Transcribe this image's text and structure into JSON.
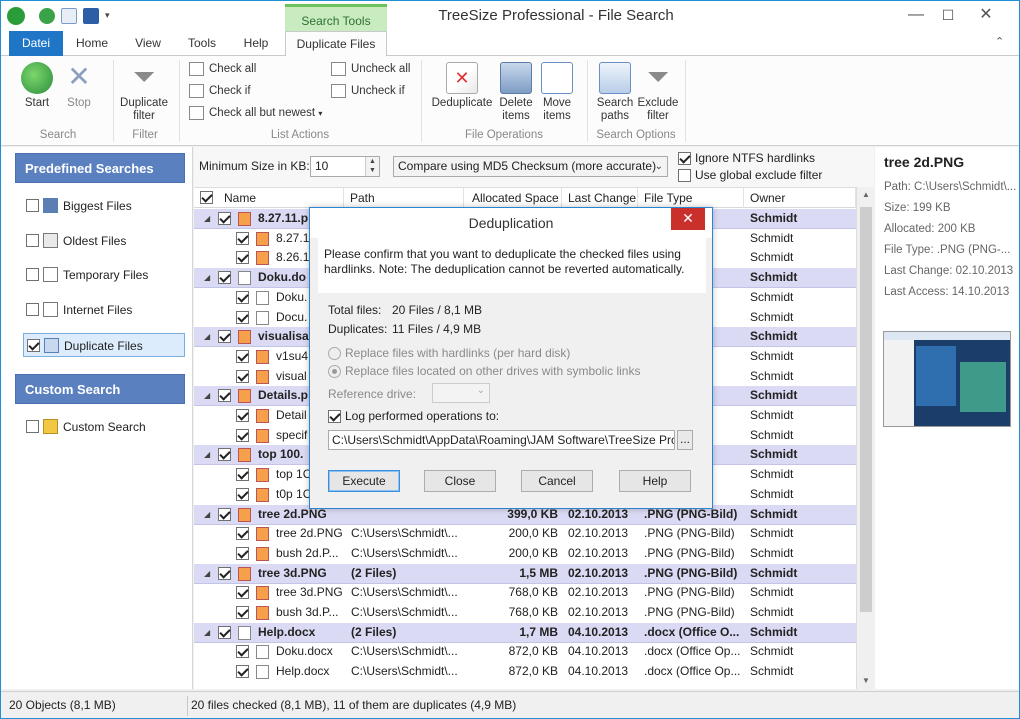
{
  "window": {
    "title": "TreeSize Professional - File Search",
    "context_tab": "Search Tools",
    "controls": {
      "minimize": "—",
      "maximize": "☐",
      "close": "✕"
    }
  },
  "ribbon_tabs": [
    "Datei",
    "Home",
    "View",
    "Tools",
    "Help",
    "Duplicate Files"
  ],
  "ribbon": {
    "start": "Start",
    "stop": "Stop",
    "search_group": "Search",
    "dup_filter_1": "Duplicate",
    "dup_filter_2": "filter",
    "filter_group": "Filter",
    "check_all": "Check all",
    "check_if": "Check if",
    "check_all_but_newest": "Check all but newest",
    "uncheck_all": "Uncheck all",
    "uncheck_if": "Uncheck if",
    "list_actions_group": "List Actions",
    "deduplicate": "Deduplicate",
    "delete_1": "Delete",
    "delete_2": "items",
    "move_1": "Move",
    "move_2": "items",
    "file_ops_group": "File Operations",
    "search_paths_1": "Search",
    "search_paths_2": "paths",
    "exclude_1": "Exclude",
    "exclude_2": "filter",
    "search_options_group": "Search Options"
  },
  "left_panel": {
    "predefined_header": "Predefined Searches",
    "predefined_items": [
      "Biggest Files",
      "Oldest Files",
      "Temporary Files",
      "Internet Files",
      "Duplicate Files"
    ],
    "custom_header": "Custom Search",
    "custom_item": "Custom Search"
  },
  "filterbar": {
    "min_size_label": "Minimum Size in KB:",
    "min_size_value": "10",
    "compare_mode": "Compare using MD5 Checksum (more accurate)",
    "ignore_hardlinks": "Ignore NTFS hardlinks",
    "global_exclude": "Use global exclude filter"
  },
  "grid": {
    "columns": [
      "Name",
      "Path",
      "Allocated Space",
      "Last Change",
      "File Type",
      "Owner"
    ],
    "rows": [
      {
        "g": true,
        "name": "8.27.11.p",
        "path": "",
        "size": "",
        "date": "",
        "type": "Bild)",
        "owner": "Schmidt"
      },
      {
        "g": false,
        "name": "8.27.1",
        "path": "",
        "size": "",
        "date": "",
        "type": "Bild)",
        "owner": "Schmidt"
      },
      {
        "g": false,
        "name": "8.26.1",
        "path": "",
        "size": "",
        "date": "",
        "type": "Bild)",
        "owner": "Schmidt"
      },
      {
        "g": true,
        "name": "Doku.do",
        "path": "",
        "size": "",
        "date": "",
        "type": "e O...",
        "owner": "Schmidt"
      },
      {
        "g": false,
        "name": "Doku.",
        "path": "",
        "size": "",
        "date": "",
        "type": "e Op...",
        "owner": "Schmidt"
      },
      {
        "g": false,
        "name": "Docu.",
        "path": "",
        "size": "",
        "date": "",
        "type": "e Op...",
        "owner": "Schmidt"
      },
      {
        "g": true,
        "name": "visualisat",
        "path": "",
        "size": "",
        "date": "",
        "type": "Bild)",
        "owner": "Schmidt"
      },
      {
        "g": false,
        "name": "v1su4",
        "path": "",
        "size": "",
        "date": "",
        "type": "Bild)",
        "owner": "Schmidt"
      },
      {
        "g": false,
        "name": "visual",
        "path": "",
        "size": "",
        "date": "",
        "type": "Bild)",
        "owner": "Schmidt"
      },
      {
        "g": true,
        "name": "Details.p",
        "path": "",
        "size": "",
        "date": "",
        "type": "Bild)",
        "owner": "Schmidt"
      },
      {
        "g": false,
        "name": "Detail",
        "path": "",
        "size": "",
        "date": "",
        "type": "Bild)",
        "owner": "Schmidt"
      },
      {
        "g": false,
        "name": "specif",
        "path": "",
        "size": "",
        "date": "",
        "type": "Bild)",
        "owner": "Schmidt"
      },
      {
        "g": true,
        "name": "top 100.",
        "path": "",
        "size": "",
        "date": "",
        "type": "Bild)",
        "owner": "Schmidt"
      },
      {
        "g": false,
        "name": "top 1C",
        "path": "",
        "size": "",
        "date": "",
        "type": "Bild)",
        "owner": "Schmidt"
      },
      {
        "g": false,
        "name": "t0p 1C",
        "path": "",
        "size": "",
        "date": "",
        "type": "Bild)",
        "owner": "Schmidt"
      },
      {
        "g": true,
        "name": "tree 2d.PNG",
        "path": "",
        "size": "399,0 KB",
        "date": "02.10.2013",
        "type": ".PNG (PNG-Bild)",
        "owner": "Schmidt"
      },
      {
        "g": false,
        "name": "tree 2d.PNG",
        "path": "C:\\Users\\Schmidt\\...",
        "size": "200,0 KB",
        "date": "02.10.2013",
        "type": ".PNG (PNG-Bild)",
        "owner": "Schmidt"
      },
      {
        "g": false,
        "name": "bush 2d.P...",
        "path": "C:\\Users\\Schmidt\\...",
        "size": "200,0 KB",
        "date": "02.10.2013",
        "type": ".PNG (PNG-Bild)",
        "owner": "Schmidt"
      },
      {
        "g": true,
        "name": "tree 3d.PNG",
        "path": "(2 Files)",
        "size": "1,5 MB",
        "date": "02.10.2013",
        "type": ".PNG (PNG-Bild)",
        "owner": "Schmidt"
      },
      {
        "g": false,
        "name": "tree 3d.PNG",
        "path": "C:\\Users\\Schmidt\\...",
        "size": "768,0 KB",
        "date": "02.10.2013",
        "type": ".PNG (PNG-Bild)",
        "owner": "Schmidt"
      },
      {
        "g": false,
        "name": "bush 3d.P...",
        "path": "C:\\Users\\Schmidt\\...",
        "size": "768,0 KB",
        "date": "02.10.2013",
        "type": ".PNG (PNG-Bild)",
        "owner": "Schmidt"
      },
      {
        "g": true,
        "name": "Help.docx",
        "path": "(2 Files)",
        "size": "1,7 MB",
        "date": "04.10.2013",
        "type": ".docx (Office O...",
        "owner": "Schmidt"
      },
      {
        "g": false,
        "name": "Doku.docx",
        "path": "C:\\Users\\Schmidt\\...",
        "size": "872,0 KB",
        "date": "04.10.2013",
        "type": ".docx (Office Op...",
        "owner": "Schmidt"
      },
      {
        "g": false,
        "name": "Help.docx",
        "path": "C:\\Users\\Schmidt\\...",
        "size": "872,0 KB",
        "date": "04.10.2013",
        "type": ".docx (Office Op...",
        "owner": "Schmidt"
      }
    ]
  },
  "right_panel": {
    "title": "tree 2d.PNG",
    "lines": [
      "Path: C:\\Users\\Schmidt\\...",
      "Size: 199 KB",
      "Allocated: 200 KB",
      "File Type: .PNG (PNG-...",
      "Last Change: 02.10.2013",
      "Last Access: 14.10.2013"
    ]
  },
  "status": {
    "left": "20 Objects (8,1 MB)",
    "right": "20 files checked (8,1 MB), 11 of them are duplicates (4,9 MB)"
  },
  "dialog": {
    "title": "Deduplication",
    "message": "Please confirm that you want to deduplicate the checked files using hardlinks. Note: The deduplication cannot be reverted automatically.",
    "total_label": "Total files:",
    "total_value": "20 Files / 8,1 MB",
    "dup_label": "Duplicates:",
    "dup_value": "11 Files / 4,9 MB",
    "opt_hardlinks": "Replace files with hardlinks (per hard disk)",
    "opt_symlinks": "Replace files located on other drives with symbolic links",
    "ref_drive": "Reference drive:",
    "log_label": "Log performed operations to:",
    "log_path": "C:\\Users\\Schmidt\\AppData\\Roaming\\JAM Software\\TreeSize Pro",
    "browse": "...",
    "execute": "Execute",
    "close": "Close",
    "cancel": "Cancel",
    "help": "Help"
  }
}
